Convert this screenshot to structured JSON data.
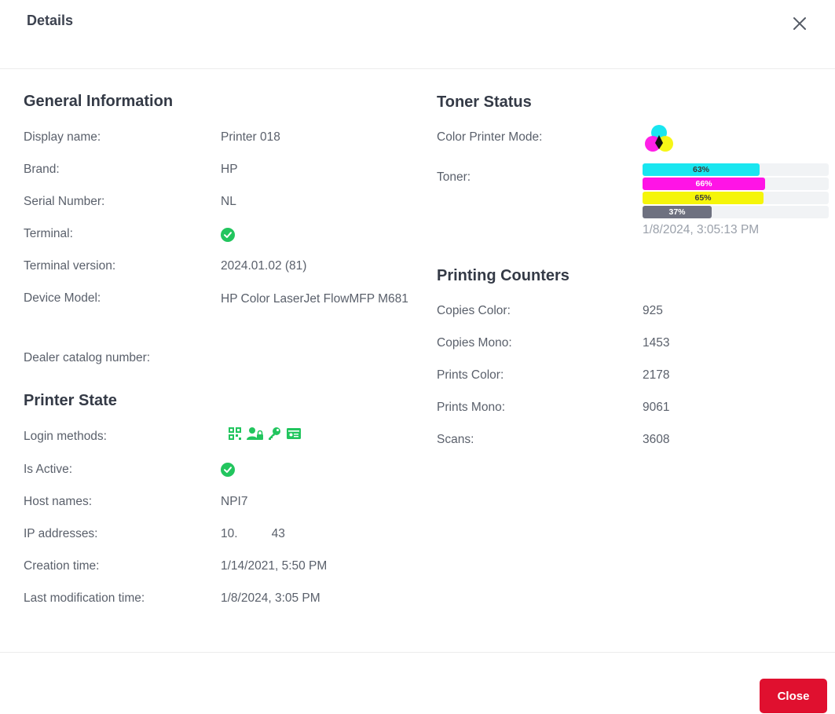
{
  "dialog": {
    "title": "Details"
  },
  "general": {
    "title": "General Information",
    "rows": [
      {
        "label": "Display name:",
        "value": "Printer 018"
      },
      {
        "label": "Brand:",
        "value": "HP"
      },
      {
        "label": "Serial Number:",
        "value": "NL"
      },
      {
        "label": "Terminal:",
        "value": "check"
      },
      {
        "label": "Terminal version:",
        "value": "2024.01.02 (81)"
      },
      {
        "label": "Device Model:",
        "value": "HP Color LaserJet FlowMFP M681"
      },
      {
        "label": "Dealer catalog number:",
        "value": ""
      }
    ]
  },
  "printer_state": {
    "title": "Printer State",
    "rows": [
      {
        "label": "Login methods:",
        "icons": [
          "qr-code-icon",
          "user-lock-icon",
          "key-icon",
          "id-card-icon"
        ]
      },
      {
        "label": "Is Active:",
        "value": "check"
      },
      {
        "label": "Host names:",
        "value": "NPI7"
      },
      {
        "label": "IP addresses:",
        "value": "10.          43"
      },
      {
        "label": "Creation time:",
        "value": "1/14/2021, 5:50 PM"
      },
      {
        "label": "Last modification time:",
        "value": "1/8/2024, 3:05 PM"
      }
    ]
  },
  "toner": {
    "title": "Toner Status",
    "color_mode_label": "Color Printer Mode:",
    "color_mode_icon": "cmyk-color-icon",
    "toner_label": "Toner:",
    "levels": [
      {
        "name": "cyan",
        "percent": 63,
        "label": "63%",
        "color": "#19e6f0",
        "text_color": "#3a3a3a"
      },
      {
        "name": "magenta",
        "percent": 66,
        "label": "66%",
        "color": "#ff14e6",
        "text_color": "#ffffff"
      },
      {
        "name": "yellow",
        "percent": 65,
        "label": "65%",
        "color": "#f5f50a",
        "text_color": "#3a3a3a"
      },
      {
        "name": "black",
        "percent": 37,
        "label": "37%",
        "color": "#6e7180",
        "text_color": "#ffffff"
      }
    ],
    "timestamp": "1/8/2024, 3:05:13 PM"
  },
  "counters": {
    "title": "Printing Counters",
    "rows": [
      {
        "label": "Copies Color:",
        "value": "925"
      },
      {
        "label": "Copies Mono:",
        "value": "1453"
      },
      {
        "label": "Prints Color:",
        "value": "2178"
      },
      {
        "label": "Prints Mono:",
        "value": "9061"
      },
      {
        "label": "Scans:",
        "value": "3608"
      }
    ]
  },
  "footer": {
    "close_label": "Close"
  },
  "colors": {
    "accent": "#e0102f",
    "success": "#22c55e"
  }
}
